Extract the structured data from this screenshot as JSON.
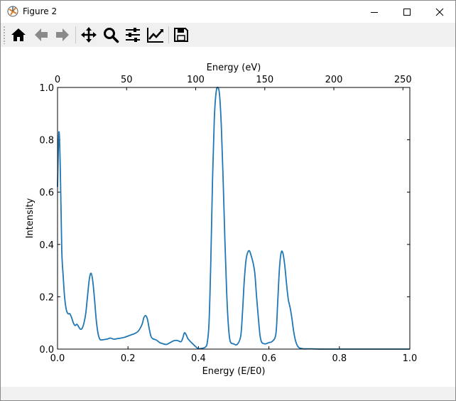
{
  "window": {
    "title": "Figure 2"
  },
  "titlebar_buttons": [
    "minimize-icon",
    "maximize-icon",
    "close-icon"
  ],
  "toolbar": {
    "buttons": [
      "home-icon",
      "back-icon",
      "forward-icon",
      "pan-icon",
      "zoom-icon",
      "configure-subplots-icon",
      "edit-axis-icon",
      "save-icon"
    ]
  },
  "chart_data": {
    "type": "line",
    "xlabel": "Energy (E/E0)",
    "ylabel": "Intensity",
    "x2label": "Energy (eV)",
    "xlim": [
      0,
      1.0
    ],
    "ylim": [
      0,
      1.0
    ],
    "x2lim": [
      0,
      255
    ],
    "xticks": [
      "0.0",
      "0.2",
      "0.4",
      "0.6",
      "0.8",
      "1.0"
    ],
    "yticks": [
      "0.0",
      "0.2",
      "0.4",
      "0.6",
      "0.8",
      "1.0"
    ],
    "x2ticks": [
      "0",
      "50",
      "100",
      "150",
      "200",
      "250"
    ],
    "line_color": "#1f77b4",
    "series": [
      {
        "x": [
          0,
          0.004,
          0.008,
          0.012,
          0.016,
          0.02,
          0.025,
          0.03,
          0.035,
          0.04,
          0.045,
          0.05,
          0.055,
          0.06,
          0.065,
          0.07,
          0.075,
          0.08,
          0.085,
          0.09,
          0.095,
          0.1,
          0.105,
          0.11,
          0.115,
          0.12,
          0.125,
          0.13,
          0.135,
          0.14,
          0.145,
          0.15,
          0.16,
          0.17,
          0.18,
          0.19,
          0.2,
          0.21,
          0.22,
          0.23,
          0.24,
          0.245,
          0.25,
          0.255,
          0.26,
          0.265,
          0.27,
          0.28,
          0.29,
          0.3,
          0.31,
          0.32,
          0.33,
          0.34,
          0.35,
          0.355,
          0.36,
          0.365,
          0.37,
          0.38,
          0.39,
          0.395,
          0.4,
          0.41,
          0.42,
          0.425,
          0.43,
          0.435,
          0.44,
          0.445,
          0.45,
          0.455,
          0.46,
          0.465,
          0.47,
          0.475,
          0.48,
          0.485,
          0.49,
          0.5,
          0.51,
          0.52,
          0.525,
          0.53,
          0.535,
          0.54,
          0.545,
          0.55,
          0.555,
          0.56,
          0.565,
          0.57,
          0.575,
          0.58,
          0.59,
          0.6,
          0.61,
          0.62,
          0.625,
          0.63,
          0.635,
          0.64,
          0.645,
          0.65,
          0.655,
          0.66,
          0.665,
          0.67,
          0.675,
          0.68,
          0.685,
          0.69,
          0.7,
          0.72,
          0.75,
          0.8,
          0.9,
          1.0
        ],
        "y": [
          0.62,
          0.83,
          0.68,
          0.38,
          0.28,
          0.2,
          0.15,
          0.135,
          0.135,
          0.12,
          0.1,
          0.09,
          0.095,
          0.085,
          0.076,
          0.08,
          0.1,
          0.135,
          0.2,
          0.265,
          0.29,
          0.26,
          0.19,
          0.11,
          0.06,
          0.038,
          0.035,
          0.036,
          0.037,
          0.038,
          0.04,
          0.042,
          0.038,
          0.04,
          0.042,
          0.045,
          0.05,
          0.055,
          0.06,
          0.07,
          0.095,
          0.12,
          0.128,
          0.115,
          0.08,
          0.05,
          0.04,
          0.035,
          0.025,
          0.02,
          0.018,
          0.025,
          0.032,
          0.033,
          0.028,
          0.04,
          0.062,
          0.055,
          0.04,
          0.025,
          0.012,
          0.006,
          0.002,
          0.003,
          0.008,
          0.025,
          0.1,
          0.33,
          0.65,
          0.88,
          0.98,
          1.0,
          0.97,
          0.85,
          0.65,
          0.42,
          0.22,
          0.09,
          0.03,
          0.02,
          0.018,
          0.05,
          0.14,
          0.26,
          0.34,
          0.37,
          0.375,
          0.355,
          0.33,
          0.29,
          0.2,
          0.12,
          0.05,
          0.025,
          0.02,
          0.025,
          0.03,
          0.06,
          0.18,
          0.31,
          0.37,
          0.365,
          0.32,
          0.25,
          0.19,
          0.16,
          0.12,
          0.07,
          0.035,
          0.015,
          0.006,
          0.003,
          0.001,
          0.001,
          0.0,
          0.0,
          0.0,
          0.0
        ]
      }
    ]
  }
}
